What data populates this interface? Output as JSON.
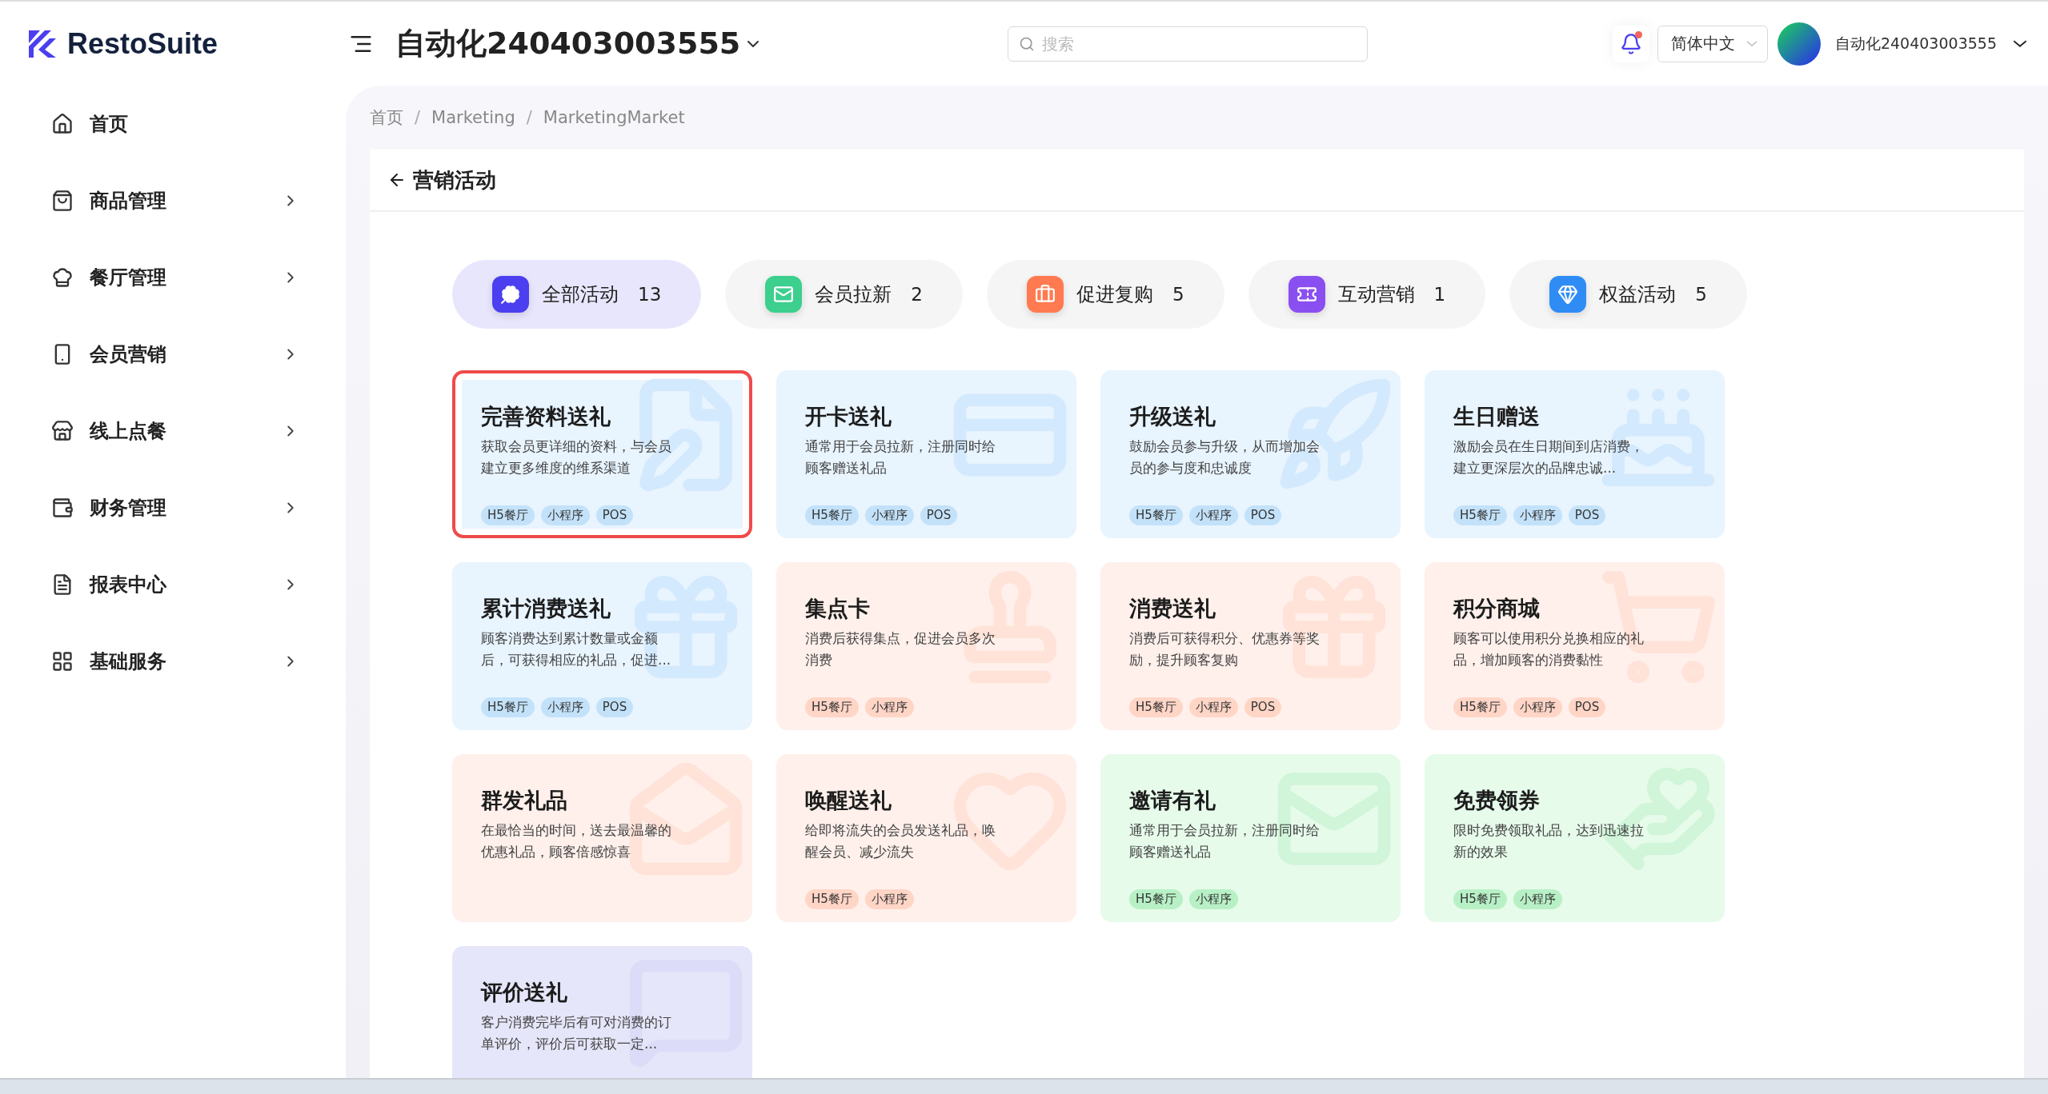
{
  "logo": {
    "text": "RestoSuite"
  },
  "header": {
    "title": "自动化240403003555",
    "search": {
      "placeholder": "搜索"
    },
    "notifications": {
      "unread": true
    },
    "language": "简体中文",
    "user": "自动化240403003555"
  },
  "sidebar": {
    "items": [
      {
        "label": "首页",
        "expandable": false
      },
      {
        "label": "商品管理",
        "expandable": true
      },
      {
        "label": "餐厅管理",
        "expandable": true
      },
      {
        "label": "会员营销",
        "expandable": true
      },
      {
        "label": "线上点餐",
        "expandable": true
      },
      {
        "label": "财务管理",
        "expandable": true
      },
      {
        "label": "报表中心",
        "expandable": true
      },
      {
        "label": "基础服务",
        "expandable": true
      }
    ]
  },
  "breadcrumb": {
    "items": [
      "首页",
      "Marketing",
      "MarketingMarket"
    ],
    "separator": "/"
  },
  "page_title": "营销活动",
  "tabs": [
    {
      "label": "全部活动",
      "count": "13",
      "selected": true,
      "color": "#4b3ff0"
    },
    {
      "label": "会员拉新",
      "count": "2",
      "selected": false,
      "color": "#3ccf8e"
    },
    {
      "label": "促进复购",
      "count": "5",
      "selected": false,
      "color": "#ff7a50"
    },
    {
      "label": "互动营销",
      "count": "1",
      "selected": false,
      "color": "#8a4ff0"
    },
    {
      "label": "权益活动",
      "count": "5",
      "selected": false,
      "color": "#2f8cf5"
    }
  ],
  "cards": [
    {
      "title": "完善资料送礼",
      "description": "获取会员更详细的资料，与会员建立更多维度的维系渠道",
      "tags": [
        "H5餐厅",
        "小程序",
        "POS"
      ],
      "color": "#e8f4fe",
      "highlighted": true
    },
    {
      "title": "开卡送礼",
      "description": "通常用于会员拉新，注册同时给顾客赠送礼品",
      "tags": [
        "H5餐厅",
        "小程序",
        "POS"
      ],
      "color": "#e8f4fe",
      "highlighted": false
    },
    {
      "title": "升级送礼",
      "description": "鼓励会员参与升级，从而增加会员的参与度和忠诚度",
      "tags": [
        "H5餐厅",
        "小程序",
        "POS"
      ],
      "color": "#e8f4fe",
      "highlighted": false
    },
    {
      "title": "生日赠送",
      "description": "激励会员在生日期间到店消费，建立更深层次的品牌忠诚...",
      "tags": [
        "H5餐厅",
        "小程序",
        "POS"
      ],
      "color": "#e8f4fe",
      "highlighted": false
    },
    {
      "title": "累计消费送礼",
      "description": "顾客消费达到累计数量或金额后，可获得相应的礼品，促进...",
      "tags": [
        "H5餐厅",
        "小程序",
        "POS"
      ],
      "color": "#e8f4fe",
      "highlighted": false
    },
    {
      "title": "集点卡",
      "description": "消费后获得集点，促进会员多次消费",
      "tags": [
        "H5餐厅",
        "小程序"
      ],
      "color": "#fff0eb",
      "highlighted": false
    },
    {
      "title": "消费送礼",
      "description": "消费后可获得积分、优惠券等奖励，提升顾客复购",
      "tags": [
        "H5餐厅",
        "小程序",
        "POS"
      ],
      "color": "#fff0eb",
      "highlighted": false
    },
    {
      "title": "积分商城",
      "description": "顾客可以使用积分兑换相应的礼品，增加顾客的消费黏性",
      "tags": [
        "H5餐厅",
        "小程序",
        "POS"
      ],
      "color": "#fff0eb",
      "highlighted": false
    },
    {
      "title": "群发礼品",
      "description": "在最恰当的时间，送去最温馨的优惠礼品，顾客倍感惊喜",
      "color": "#fff0eb",
      "highlighted": false
    },
    {
      "title": "唤醒送礼",
      "description": "给即将流失的会员发送礼品，唤醒会员、减少流失",
      "tags": [
        "H5餐厅",
        "小程序"
      ],
      "color": "#fff0eb",
      "highlighted": false
    },
    {
      "title": "邀请有礼",
      "description": "通常用于会员拉新，注册同时给顾客赠送礼品",
      "tags": [
        "H5餐厅",
        "小程序"
      ],
      "color": "#e6fbea",
      "highlighted": false
    },
    {
      "title": "免费领券",
      "description": "限时免费领取礼品，达到迅速拉新的效果",
      "tags": [
        "H5餐厅",
        "小程序"
      ],
      "color": "#e6fbea",
      "highlighted": false
    },
    {
      "title": "评价送礼",
      "description": "客户消费完毕后有可对消费的订单评价，评价后可获取一定...",
      "color": "#e6e6fa",
      "highlighted": false
    }
  ]
}
